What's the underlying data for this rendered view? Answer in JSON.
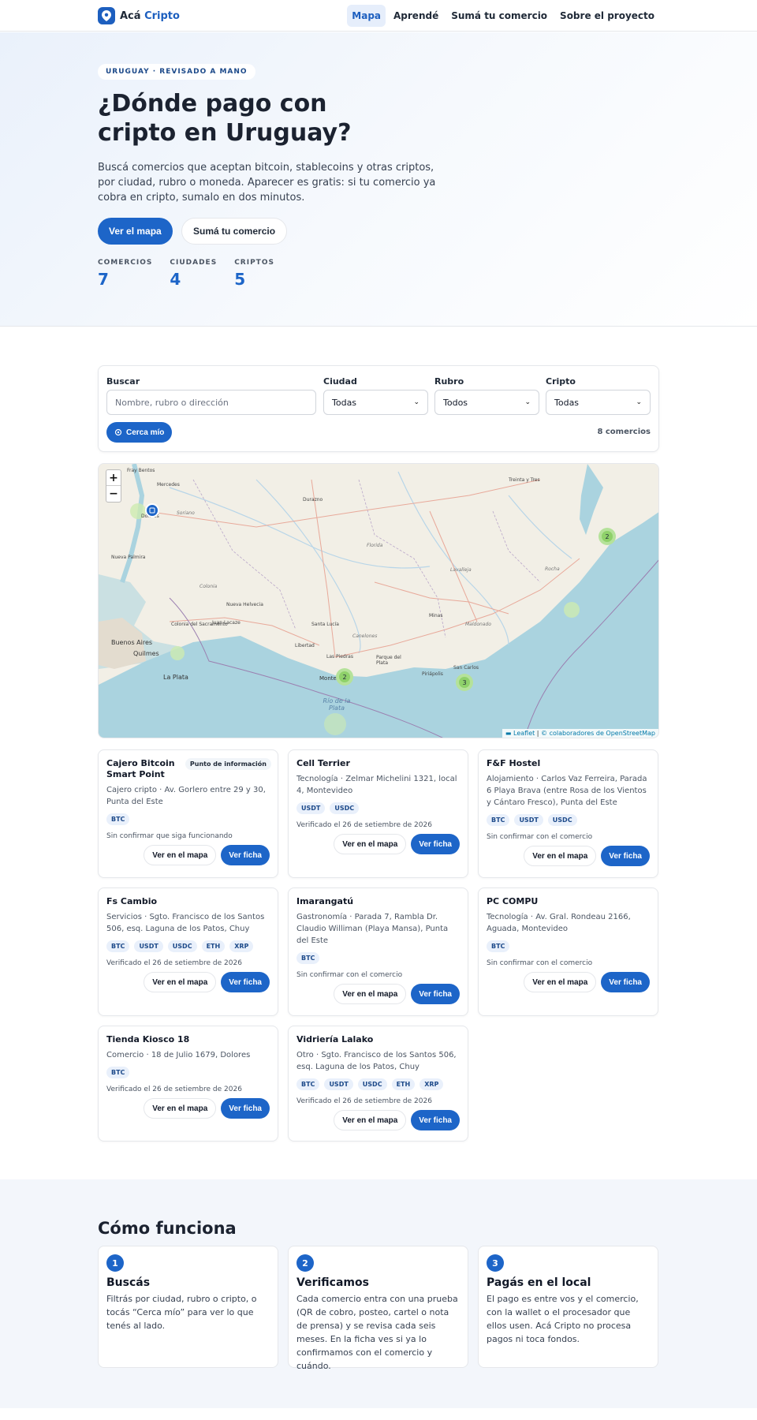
{
  "nav": {
    "brand_prefix": "Acá",
    "brand_accent": "Cripto",
    "links": [
      "Mapa",
      "Aprendé",
      "Sumá tu comercio",
      "Sobre el proyecto"
    ]
  },
  "hero": {
    "eyebrow": "URUGUAY · REVISADO A MANO",
    "title": "¿Dónde pago con cripto en Uruguay?",
    "description": "Buscá comercios que aceptan bitcoin, stablecoins y otras criptos, por ciudad, rubro o moneda. Aparecer es gratis: si tu comercio ya cobra en cripto, sumalo en dos minutos.",
    "primary_button": "Ver el mapa",
    "secondary_button": "Sumá tu comercio",
    "stats": [
      {
        "label": "COMERCIOS",
        "value": "7"
      },
      {
        "label": "CIUDADES",
        "value": "4"
      },
      {
        "label": "CRIPTOS",
        "value": "5"
      }
    ]
  },
  "filters": {
    "search_label": "Buscar",
    "search_placeholder": "Nombre, rubro o dirección",
    "city_label": "Ciudad",
    "city_value": "Todas",
    "category_label": "Rubro",
    "category_value": "Todos",
    "crypto_label": "Cripto",
    "crypto_value": "Todas",
    "near_button": "Cerca mío",
    "result_count": "8 comercios"
  },
  "map": {
    "zoom_in": "+",
    "zoom_out": "−",
    "attribution_leaflet": "Leaflet",
    "attribution_osm": "© colaboradores de OpenStreetMap",
    "clusters": [
      "2",
      "2",
      "3"
    ],
    "place_labels": [
      "Fray Bentos",
      "Mercedes",
      "Dolores",
      "Soriano",
      "Nueva Palmira",
      "Colonia",
      "Nueva Helvecia",
      "Colonia del Sacramento",
      "Juan Lacaze",
      "Buenos Aires",
      "Quilmes",
      "La Plata",
      "Durazno",
      "Florida",
      "Lavalleja",
      "Rocha",
      "Treinta y Tres",
      "Minas",
      "Maldonado",
      "Canelones",
      "Las Piedras",
      "Libertad",
      "Santa Lucía",
      "Parque del Plata",
      "Piriápolis",
      "San Carlos",
      "Montevideo",
      "Río de la Plata"
    ]
  },
  "cards": [
    {
      "title": "Cajero Bitcoin Smart Point",
      "badge": "Punto de información",
      "meta": "Cajero cripto · Av. Gorlero entre 29 y 30, Punta del Este",
      "tags": [
        "BTC"
      ],
      "status": "Sin confirmar que siga funcionando",
      "map_button": "Ver en el mapa",
      "detail_button": "Ver ficha"
    },
    {
      "title": "Cell Terrier",
      "meta": "Tecnología · Zelmar Michelini 1321, local 4, Montevideo",
      "tags": [
        "USDT",
        "USDC"
      ],
      "status": "Verificado el 26 de setiembre de 2026",
      "map_button": "Ver en el mapa",
      "detail_button": "Ver ficha"
    },
    {
      "title": "F&F Hostel",
      "meta": "Alojamiento · Carlos Vaz Ferreira, Parada 6 Playa Brava (entre Rosa de los Vientos y Cántaro Fresco), Punta del Este",
      "tags": [
        "BTC",
        "USDT",
        "USDC"
      ],
      "status": "Sin confirmar con el comercio",
      "map_button": "Ver en el mapa",
      "detail_button": "Ver ficha"
    },
    {
      "title": "Fs Cambio",
      "meta": "Servicios · Sgto. Francisco de los Santos 506, esq. Laguna de los Patos, Chuy",
      "tags": [
        "BTC",
        "USDT",
        "USDC",
        "ETH",
        "XRP"
      ],
      "status": "Verificado el 26 de setiembre de 2026",
      "map_button": "Ver en el mapa",
      "detail_button": "Ver ficha"
    },
    {
      "title": "Imarangatú",
      "meta": "Gastronomía · Parada 7, Rambla Dr. Claudio Williman (Playa Mansa), Punta del Este",
      "tags": [
        "BTC"
      ],
      "status": "Sin confirmar con el comercio",
      "map_button": "Ver en el mapa",
      "detail_button": "Ver ficha"
    },
    {
      "title": "PC COMPU",
      "meta": "Tecnología · Av. Gral. Rondeau 2166, Aguada, Montevideo",
      "tags": [
        "BTC"
      ],
      "status": "Sin confirmar con el comercio",
      "map_button": "Ver en el mapa",
      "detail_button": "Ver ficha"
    },
    {
      "title": "Tienda Kiosco 18",
      "meta": "Comercio · 18 de Julio 1679, Dolores",
      "tags": [
        "BTC"
      ],
      "status": "Verificado el 26 de setiembre de 2026",
      "map_button": "Ver en el mapa",
      "detail_button": "Ver ficha"
    },
    {
      "title": "Vidriería Lalako",
      "meta": "Otro · Sgto. Francisco de los Santos 506, esq. Laguna de los Patos, Chuy",
      "tags": [
        "BTC",
        "USDT",
        "USDC",
        "ETH",
        "XRP"
      ],
      "status": "Verificado el 26 de setiembre de 2026",
      "map_button": "Ver en el mapa",
      "detail_button": "Ver ficha"
    }
  ],
  "how": {
    "title": "Cómo funciona",
    "steps": [
      {
        "num": "1",
        "title": "Buscás",
        "text": "Filtrás por ciudad, rubro o cripto, o tocás “Cerca mío” para ver lo que tenés al lado."
      },
      {
        "num": "2",
        "title": "Verificamos",
        "text": "Cada comercio entra con una prueba (QR de cobro, posteo, cartel o nota de prensa) y se revisa cada seis meses. En la ficha ves si ya lo confirmamos con el comercio y cuándo."
      },
      {
        "num": "3",
        "title": "Pagás en el local",
        "text": "El pago es entre vos y el comercio, con la wallet o el procesador que ellos usen. Acá Cripto no procesa pagos ni toca fondos."
      }
    ]
  },
  "colors": {
    "accent": "#1d65c8",
    "tag_bg": "#e9f0fb",
    "cluster": "#8fd16a"
  }
}
